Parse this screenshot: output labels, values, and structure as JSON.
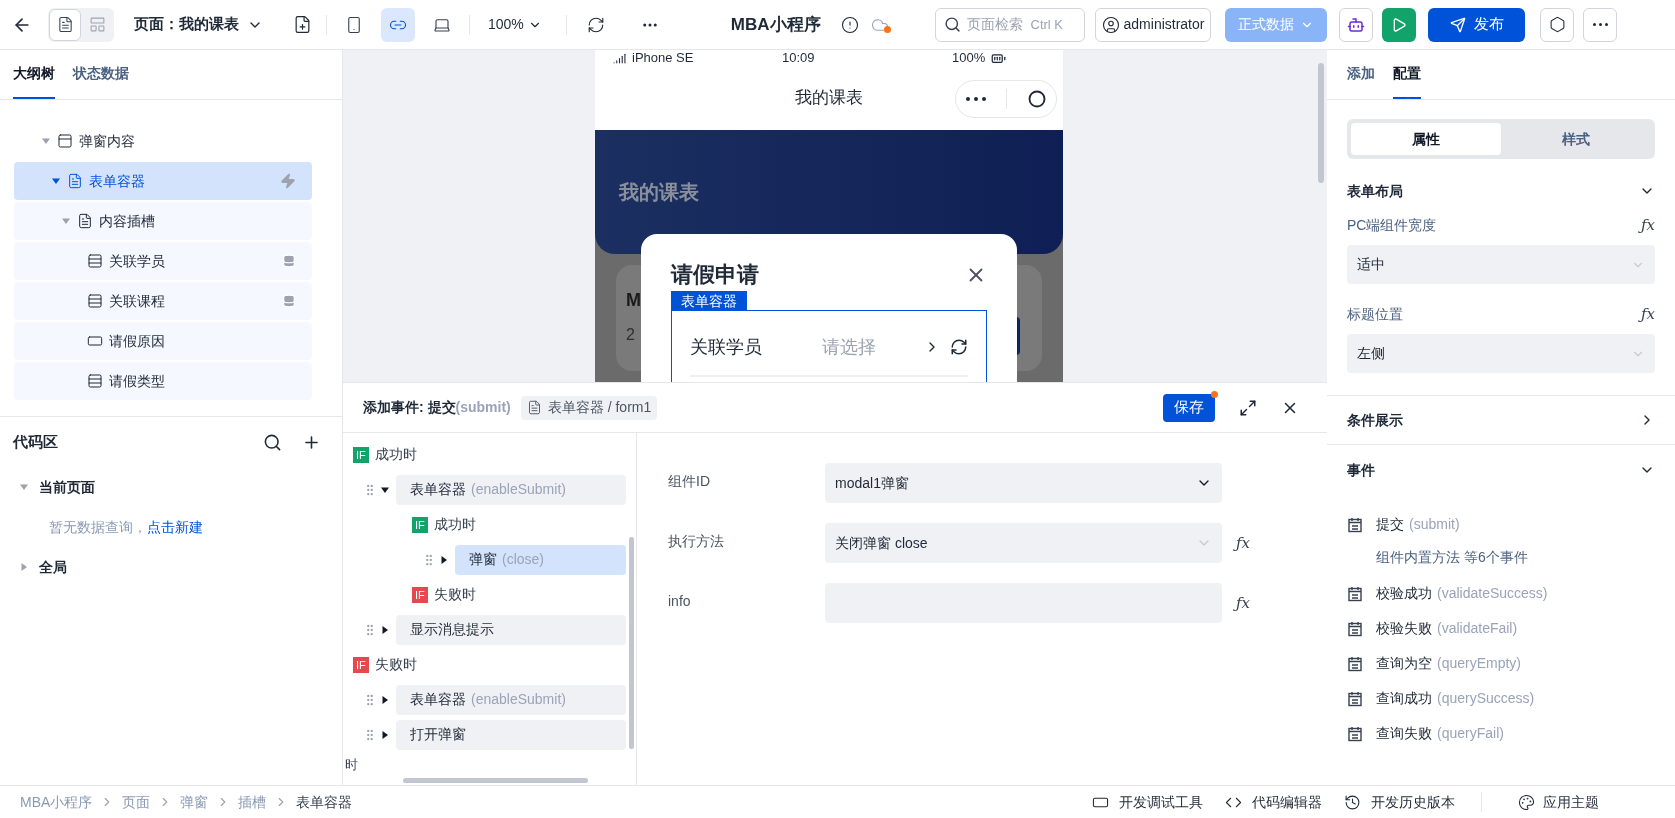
{
  "toolbar": {
    "view_modes": [
      {
        "kind": "outline",
        "selected": true
      },
      {
        "kind": "layout",
        "selected": false
      }
    ],
    "page_label": "页面：我的课表",
    "devices": [
      {
        "kind": "phone",
        "selected": false
      },
      {
        "kind": "miniprogram",
        "selected": true
      },
      {
        "kind": "desktop",
        "selected": false
      }
    ],
    "zoom": "100%",
    "app_title": "MBA小程序",
    "cloud_unsynced": true,
    "search": {
      "placeholder": "页面检索",
      "shortcut": "Ctrl K"
    },
    "user": "administrator",
    "data_env": {
      "label": "正式数据",
      "disabled": true
    },
    "publish": "发布"
  },
  "left_panel": {
    "tabs": [
      {
        "label": "大纲树",
        "selected": true
      },
      {
        "label": "状态数据",
        "selected": false
      }
    ],
    "outline": [
      {
        "label": "弹窗内容",
        "kind": "panel",
        "expanded": true,
        "selected": false,
        "children": [
          {
            "label": "表单容器",
            "kind": "form",
            "expanded": true,
            "selected": true,
            "has_events": true,
            "children": [
              {
                "label": "内容插槽",
                "kind": "form",
                "expanded": true,
                "selected": false,
                "children": [
                  {
                    "label": "关联学员",
                    "kind": "select",
                    "selected": false,
                    "data_bound": true
                  },
                  {
                    "label": "关联课程",
                    "kind": "select",
                    "selected": false,
                    "data_bound": true
                  },
                  {
                    "label": "请假原因",
                    "kind": "input",
                    "selected": false,
                    "data_bound": false
                  },
                  {
                    "label": "请假类型",
                    "kind": "select",
                    "selected": false,
                    "data_bound": false
                  }
                ]
              }
            ]
          }
        ]
      }
    ],
    "code_area": {
      "title": "代码区",
      "groups": [
        {
          "label": "当前页面",
          "expanded": true,
          "empty_text": "暂无数据查询，",
          "empty_link": "点击新建"
        },
        {
          "label": "全局",
          "expanded": false
        }
      ]
    }
  },
  "phone": {
    "status": {
      "device": "iPhone SE",
      "time": "10:09",
      "battery": "100%"
    },
    "nav_title": "我的课表",
    "header_title": "我的课表",
    "card_fragments": [
      "M",
      "2"
    ],
    "modal": {
      "title": "请假申请",
      "container_tag": "表单容器",
      "field": {
        "label": "关联学员",
        "placeholder": "请选择"
      }
    }
  },
  "event_panel": {
    "title": "添加事件: 提交",
    "title_code": "(submit)",
    "breadcrumb": "表单容器 / form1",
    "save": "保存",
    "unsaved": true,
    "tree": [
      {
        "kind": "if",
        "success": true,
        "badge": "IF",
        "label": "成功时",
        "children": [
          {
            "kind": "action",
            "label": "表单容器",
            "code": "(enableSubmit)",
            "expanded": true,
            "selected": false,
            "children": [
              {
                "kind": "if",
                "success": true,
                "badge": "IF",
                "label": "成功时",
                "children": [
                  {
                    "kind": "action",
                    "label": "弹窗",
                    "code": "(close)",
                    "expanded": false,
                    "selected": true
                  }
                ]
              },
              {
                "kind": "if",
                "success": false,
                "badge": "IF",
                "label": "失败时"
              }
            ]
          },
          {
            "kind": "action",
            "label": "显示消息提示",
            "expanded": false,
            "selected": false
          }
        ]
      },
      {
        "kind": "if",
        "success": false,
        "badge": "IF",
        "label": "失败时",
        "children": [
          {
            "kind": "action",
            "label": "表单容器",
            "code": "(enableSubmit)",
            "expanded": false,
            "selected": false
          },
          {
            "kind": "action",
            "label": "打开弹窗",
            "expanded": false,
            "selected": false
          }
        ]
      }
    ],
    "cut_text": "时",
    "fields": [
      {
        "label": "组件ID",
        "kind": "select",
        "value": "modal1弹窗",
        "disabled": false
      },
      {
        "label": "执行方法",
        "kind": "select",
        "value": "关闭弹窗 close",
        "disabled": true,
        "fx": "ƒx"
      },
      {
        "label": "info",
        "kind": "input",
        "fx": "ƒx"
      }
    ]
  },
  "right_panel": {
    "tabs": [
      {
        "label": "添加",
        "selected": false
      },
      {
        "label": "配置",
        "selected": true
      }
    ],
    "segments": [
      {
        "label": "属性",
        "selected": true
      },
      {
        "label": "样式",
        "selected": false
      }
    ],
    "layout_section": {
      "title": "表单布局",
      "expanded": true,
      "props": [
        {
          "label": "PC端组件宽度",
          "value": "适中",
          "fx": "ƒx"
        },
        {
          "label": "标题位置",
          "value": "左侧",
          "fx": "ƒx"
        }
      ]
    },
    "condition_section": {
      "title": "条件展示",
      "expanded": false
    },
    "events_section": {
      "title": "事件",
      "expanded": true,
      "events": [
        {
          "label": "提交",
          "code": "(submit)",
          "note": "组件内置方法 等6个事件"
        },
        {
          "label": "校验成功",
          "code": "(validateSuccess)"
        },
        {
          "label": "校验失败",
          "code": "(validateFail)"
        },
        {
          "label": "查询为空",
          "code": "(queryEmpty)"
        },
        {
          "label": "查询成功",
          "code": "(querySuccess)"
        },
        {
          "label": "查询失败",
          "code": "(queryFail)"
        }
      ]
    }
  },
  "status_bar": {
    "breadcrumb": [
      "MBA小程序",
      "页面",
      "弹窗",
      "插槽",
      "表单容器"
    ],
    "tools": [
      {
        "kind": "debug",
        "label": "开发调试工具"
      },
      {
        "kind": "code",
        "label": "代码编辑器"
      },
      {
        "kind": "history",
        "label": "开发历史版本"
      }
    ],
    "theme": "应用主题"
  }
}
